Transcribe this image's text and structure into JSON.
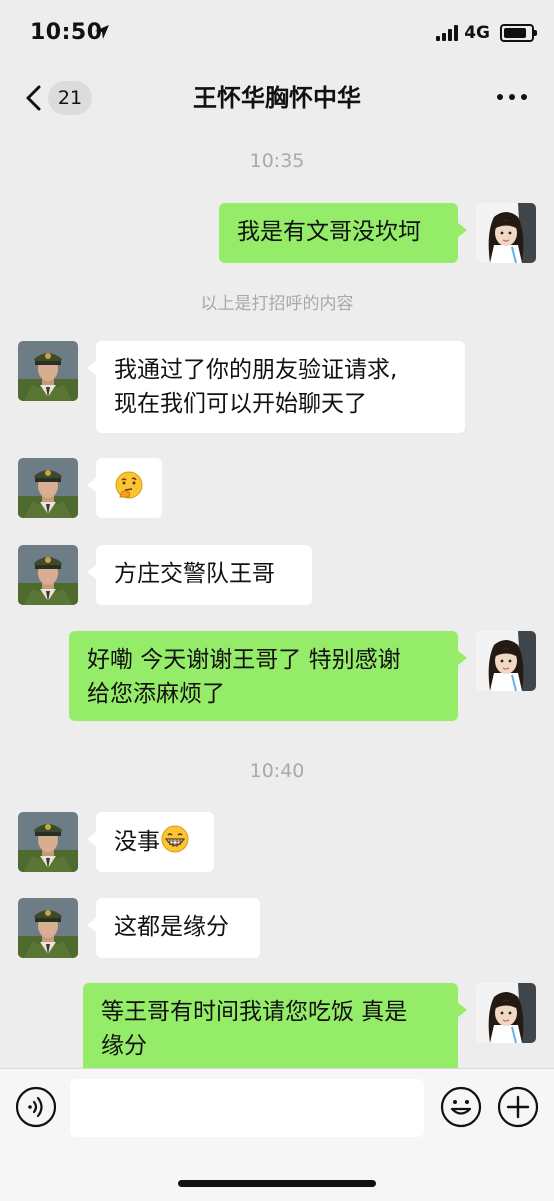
{
  "status_bar": {
    "time": "10:50",
    "network": "4G"
  },
  "header": {
    "unread_count": "21",
    "title": "王怀华胸怀中华"
  },
  "messages": [
    {
      "type": "time",
      "text": "10:35"
    },
    {
      "type": "msg",
      "from": "me",
      "text": "我是有文哥没坎坷"
    },
    {
      "type": "system",
      "text": "以上是打招呼的内容"
    },
    {
      "type": "msg",
      "from": "other",
      "lines": [
        "我通过了你的朋友验证请求,",
        "现在我们可以开始聊天了"
      ]
    },
    {
      "type": "msg",
      "from": "other",
      "emoji": "thinking-face"
    },
    {
      "type": "msg",
      "from": "other",
      "text": "方庄交警队王哥"
    },
    {
      "type": "msg",
      "from": "me",
      "lines": [
        "好嘞 今天谢谢王哥了 特别感谢",
        "给您添麻烦了"
      ]
    },
    {
      "type": "time",
      "text": "10:40"
    },
    {
      "type": "msg",
      "from": "other",
      "text": "没事",
      "emoji": "grinning-face"
    },
    {
      "type": "msg",
      "from": "other",
      "text": "这都是缘分"
    },
    {
      "type": "msg",
      "from": "me",
      "lines": [
        "等王哥有时间我请您吃饭 真是",
        "缘分"
      ]
    }
  ],
  "input_bar": {
    "placeholder": ""
  },
  "colors": {
    "background": "#ededed",
    "my_bubble": "#95ec69",
    "other_bubble": "#ffffff"
  }
}
